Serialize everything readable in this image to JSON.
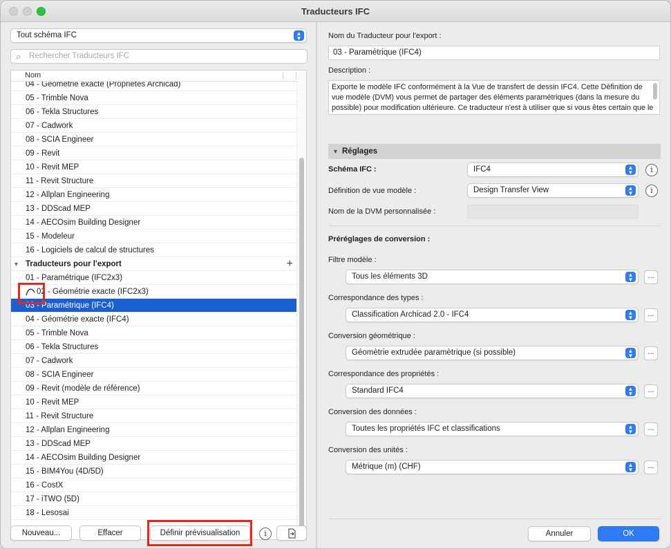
{
  "window": {
    "title": "Traducteurs IFC"
  },
  "left": {
    "schema_select": "Tout schéma IFC",
    "search_placeholder": "Rechercher Traducteurs IFC",
    "column_header": "Nom",
    "import_items": [
      "04 - Géométrie exacte (Propriétés Archicad)",
      "05 - Trimble Nova",
      "06 - Tekla Structures",
      "07 - Cadwork",
      "08 - SCIA Engineer",
      "09 - Revit",
      "10 - Revit MEP",
      "11 - Revit Structure",
      "12 - Allplan Engineering",
      "13 - DDScad MEP",
      "14 - AECOsim Building Designer",
      "15 - Modeleur",
      "16 - Logiciels de calcul de structures"
    ],
    "export_group": "Traducteurs pour l'export",
    "export_items": [
      "01 - Paramétrique (IFC2x3)",
      "02 - Géométrie exacte (IFC2x3)",
      "03 - Paramétrique (IFC4)",
      "04 - Géométrie exacte (IFC4)",
      "05 - Trimble Nova",
      "06 - Tekla Structures",
      "07 - Cadwork",
      "08 - SCIA Engineer",
      "09 - Revit (modèle de référence)",
      "10 - Revit MEP",
      "11 - Revit Structure",
      "12 - Allplan Engineering",
      "13 - DDScad MEP",
      "14 - AECOsim Building Designer",
      "15 - BIM4You (4D/5D)",
      "16 - CostX",
      "17 - iTWO (5D)",
      "18 - Lesosai"
    ],
    "selected_item": "03 - Paramétrique (IFC4)",
    "buttons": {
      "new": "Nouveau...",
      "delete": "Effacer",
      "preview": "Définir prévisualisation"
    }
  },
  "right": {
    "name_label": "Nom du Traducteur pour l'export :",
    "name_value": "03 - Paramétrique (IFC4)",
    "description_label": "Description :",
    "description_text": "Exporte le modèle IFC conformément à la Vue de transfert de dessin IFC4. Cette Définition de vue modèle (DVM) vous permet de partager des éléments paramétriques (dans la mesure du possible) pour modification ultérieure. Ce traducteur n'est à utiliser que si vous êtes certain que le logiciel de destination est capable de prendre en charge",
    "settings_header": "Réglages",
    "schema_label": "Schéma IFC :",
    "schema_value": "IFC4",
    "mvd_label": "Définition de vue modèle :",
    "mvd_value": "Design Transfer View",
    "custom_mvd_label": "Nom de la DVM personnalisée :",
    "presets_label": "Préréglages de conversion :",
    "presets": [
      {
        "label": "Filtre modèle :",
        "value": "Tous les éléments 3D"
      },
      {
        "label": "Correspondance des types :",
        "value": "Classification Archicad 2.0 - IFC4"
      },
      {
        "label": "Conversion géométrique :",
        "value": "Géomètrie extrudée paramètrique (si possible)"
      },
      {
        "label": "Correspondance des propriétés :",
        "value": "Standard IFC4"
      },
      {
        "label": "Conversion des données :",
        "value": "Toutes les propriétés IFC et classifications"
      },
      {
        "label": "Conversion des unités :",
        "value": "Métrique (m) (CHF)"
      }
    ],
    "dots_label": "...",
    "cancel": "Annuler",
    "ok": "OK"
  },
  "colors": {
    "accent": "#2f7bf5",
    "selection": "#1a5fd0",
    "highlight_box": "#e8261c"
  }
}
